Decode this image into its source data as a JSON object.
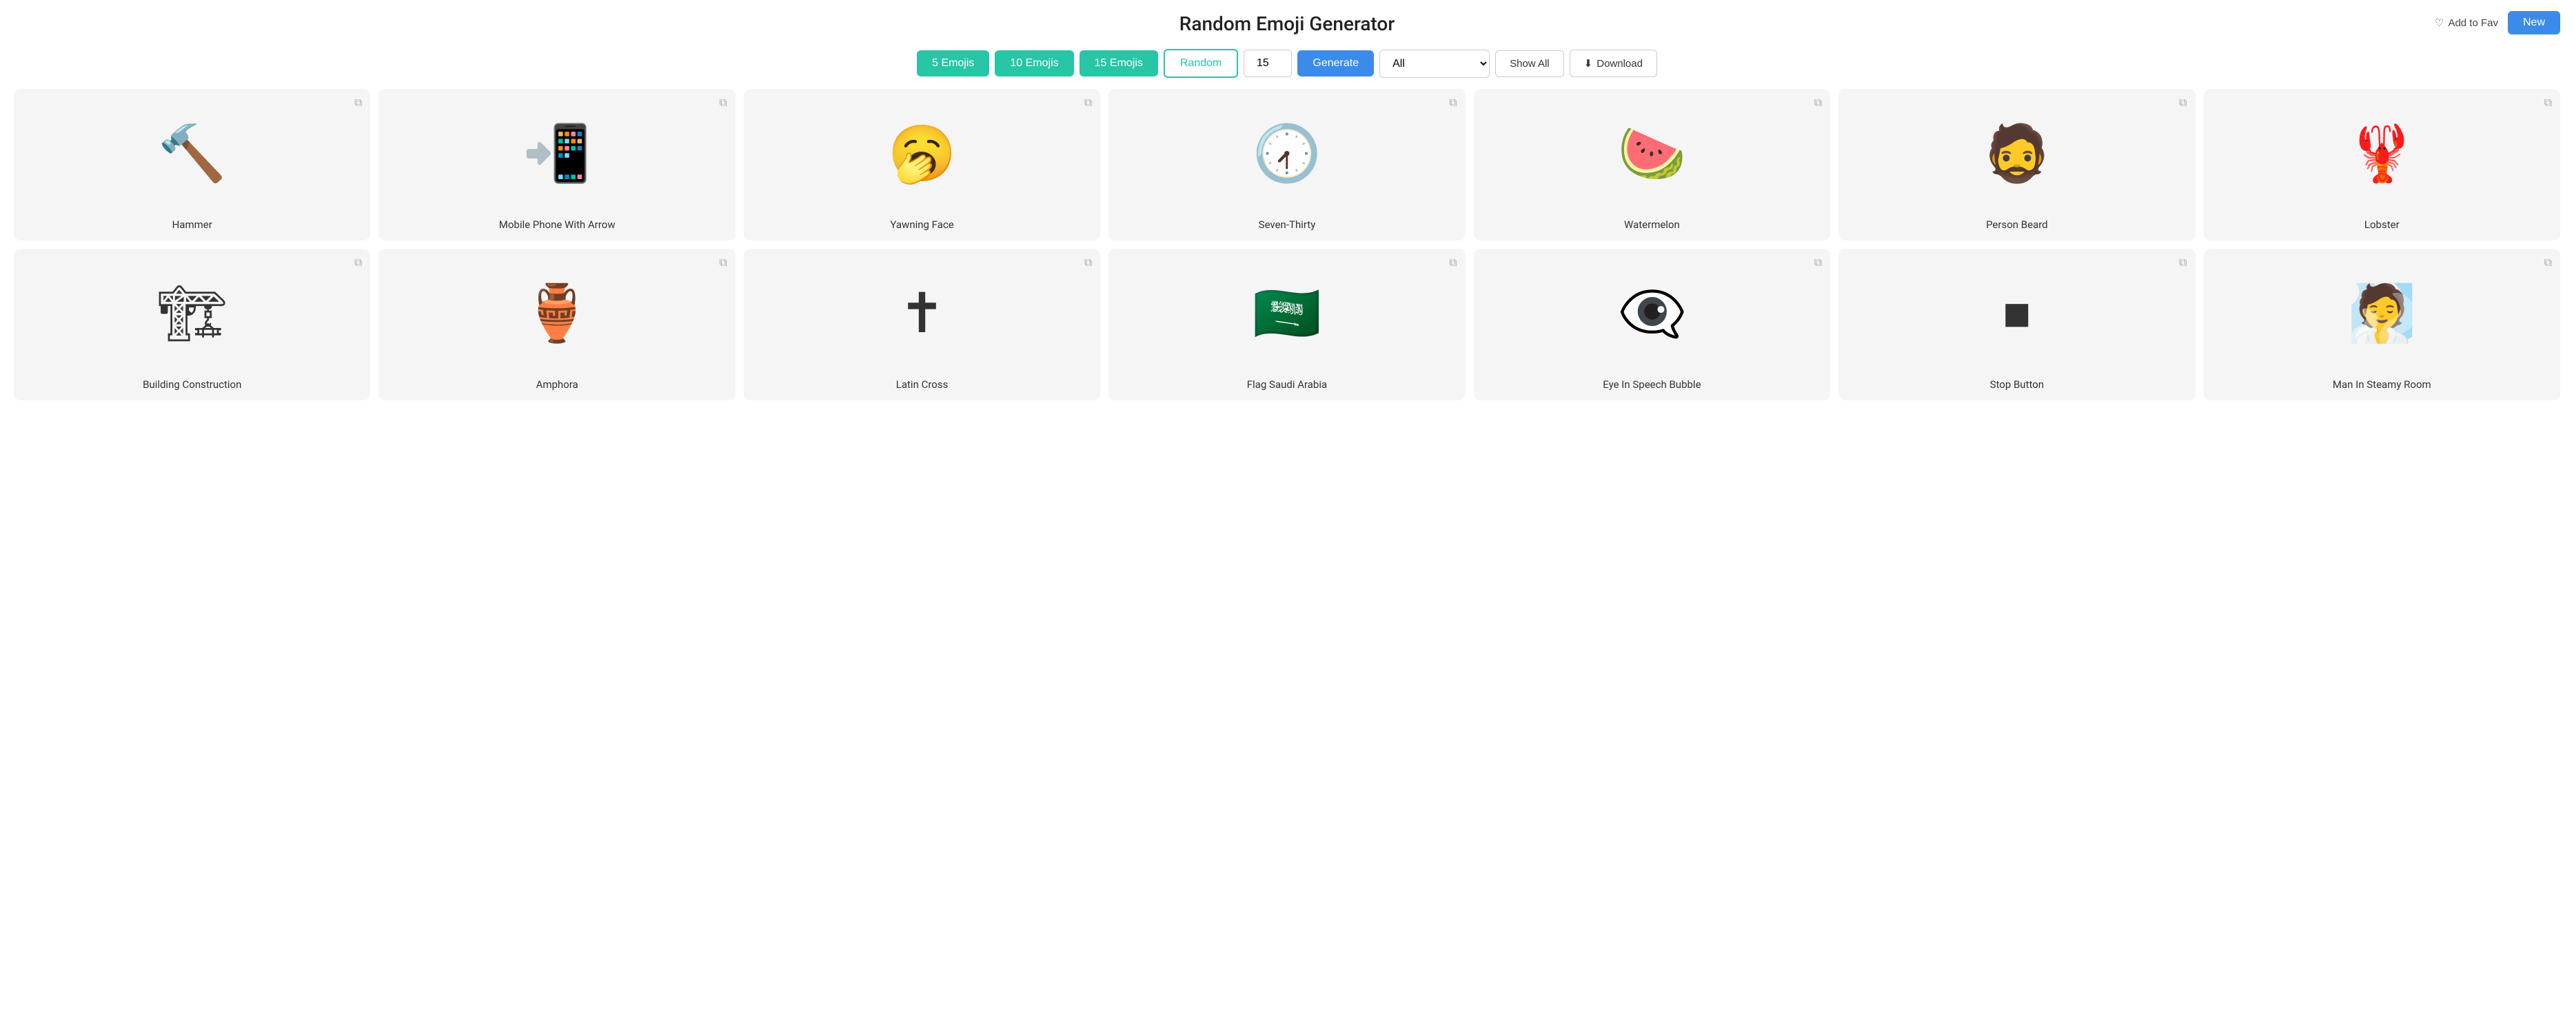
{
  "page": {
    "title": "Random Emoji Generator"
  },
  "toolbar": {
    "btn5": "5 Emojis",
    "btn10": "10 Emojis",
    "btn15": "15 Emojis",
    "btnRandom": "Random",
    "numberValue": "15",
    "btnGenerate": "Generate",
    "dropdownValue": "All",
    "btnShowAll": "Show All",
    "btnDownloadIcon": "⬇",
    "btnDownload": "Download"
  },
  "topRight": {
    "addToFav": "Add to Fav",
    "btnNew": "New"
  },
  "emojis": [
    {
      "emoji": "🔨",
      "label": "Hammer"
    },
    {
      "emoji": "📲",
      "label": "Mobile Phone With Arrow"
    },
    {
      "emoji": "🥱",
      "label": "Yawning Face"
    },
    {
      "emoji": "🕢",
      "label": "Seven-Thirty"
    },
    {
      "emoji": "🍉",
      "label": "Watermelon"
    },
    {
      "emoji": "🧔",
      "label": "Person Beard"
    },
    {
      "emoji": "🦞",
      "label": "Lobster"
    },
    {
      "emoji": "🏗",
      "label": "Building Construction"
    },
    {
      "emoji": "🏺",
      "label": "Amphora"
    },
    {
      "emoji": "✝",
      "label": "Latin Cross"
    },
    {
      "emoji": "🇸🇦",
      "label": "Flag Saudi Arabia"
    },
    {
      "emoji": "👁‍🗨",
      "label": "Eye In Speech Bubble"
    },
    {
      "emoji": "⏹",
      "label": "Stop Button"
    },
    {
      "emoji": "🧖",
      "label": "Man In Steamy Room"
    }
  ]
}
